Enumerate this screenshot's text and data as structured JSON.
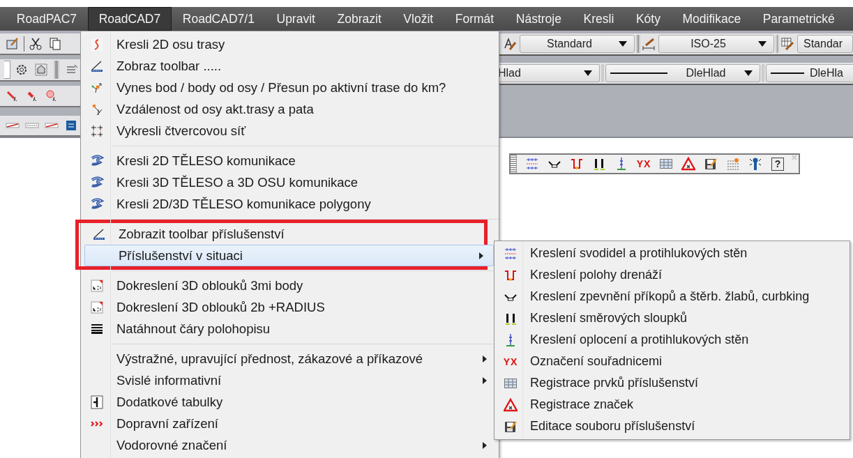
{
  "menubar": [
    {
      "label": "RoadPAC7",
      "selected": false
    },
    {
      "label": "RoadCAD7",
      "selected": true
    },
    {
      "label": "RoadCAD7/1",
      "selected": false
    },
    {
      "label": "Upravit",
      "selected": false
    },
    {
      "label": "Zobrazit",
      "selected": false
    },
    {
      "label": "Vložit",
      "selected": false
    },
    {
      "label": "Formát",
      "selected": false
    },
    {
      "label": "Nástroje",
      "selected": false
    },
    {
      "label": "Kresli",
      "selected": false
    },
    {
      "label": "Kóty",
      "selected": false
    },
    {
      "label": "Modifikace",
      "selected": false
    },
    {
      "label": "Parametrické",
      "selected": false
    }
  ],
  "toolbar_rows": [
    [
      {
        "kind": "textstyle",
        "value": "Standard"
      },
      {
        "kind": "dimstyle",
        "value": "ISO-25"
      },
      {
        "kind": "tablestyle",
        "value": "Standar"
      }
    ],
    [
      {
        "kind": "plain",
        "value": "Hlad"
      },
      {
        "kind": "linetype",
        "value": "DleHlad"
      },
      {
        "kind": "linetype",
        "value": "DleHla"
      }
    ]
  ],
  "floating_toolbar": {
    "items": [
      {
        "kind": "guardrail"
      },
      {
        "kind": "ditch"
      },
      {
        "kind": "drain"
      },
      {
        "kind": "posts"
      },
      {
        "kind": "fence"
      },
      {
        "kind": "coords",
        "text": "YX"
      },
      {
        "kind": "table"
      },
      {
        "kind": "warning"
      },
      {
        "kind": "edit"
      },
      {
        "kind": "markings"
      },
      {
        "kind": "pillar"
      },
      {
        "kind": "help",
        "text": "?"
      }
    ]
  },
  "menu": {
    "items": [
      {
        "kind": "curve",
        "label": "Kresli 2D osu trasy",
        "submenu": false,
        "selected": false,
        "outlined": false
      },
      {
        "kind": "ruler",
        "label": "Zobraz toolbar .....",
        "submenu": false,
        "selected": false,
        "outlined": false
      },
      {
        "kind": "points",
        "label": "Vynes bod / body od osy / Přesun po aktivní trase do km?",
        "submenu": false,
        "selected": false,
        "outlined": false
      },
      {
        "kind": "offset",
        "label": "Vzdálenost od osy akt.trasy a pata",
        "submenu": false,
        "selected": false,
        "outlined": false
      },
      {
        "kind": "grid",
        "label": "Vykresli čtvercovou síť",
        "submenu": false,
        "selected": false,
        "outlined": false
      },
      {
        "kind": "separator"
      },
      {
        "kind": "road",
        "label": "Kresli 2D TĚLESO komunikace",
        "submenu": false,
        "selected": false,
        "outlined": false
      },
      {
        "kind": "road",
        "label": "Kresli 3D TĚLESO a 3D OSU komunikace",
        "submenu": false,
        "selected": false,
        "outlined": false
      },
      {
        "kind": "road",
        "label": "Kresli 2D/3D TĚLESO komunikace polygony",
        "submenu": false,
        "selected": false,
        "outlined": false
      },
      {
        "kind": "separator"
      },
      {
        "kind": "ruler",
        "label": "Zobrazit toolbar příslušenství",
        "submenu": false,
        "selected": false,
        "outlined": true
      },
      {
        "kind": "plain",
        "label": "Příslušenství v situaci",
        "submenu": true,
        "selected": true,
        "outlined": true
      },
      {
        "kind": "separator"
      },
      {
        "kind": "lsp",
        "label": "Dokreslení 3D oblouků 3mi body",
        "submenu": false,
        "selected": false,
        "outlined": false
      },
      {
        "kind": "lsp",
        "label": "Dokreslení 3D oblouků 2b +RADIUS",
        "submenu": false,
        "selected": false,
        "outlined": false
      },
      {
        "kind": "lines",
        "label": "Natáhnout čáry polohopisu",
        "submenu": false,
        "selected": false,
        "outlined": false
      },
      {
        "kind": "separator"
      },
      {
        "kind": "plain",
        "label": "Výstražné, upravující přednost, zákazové a příkazové",
        "submenu": true,
        "selected": false,
        "outlined": false
      },
      {
        "kind": "plain",
        "label": "Svislé informativní",
        "submenu": true,
        "selected": false,
        "outlined": false
      },
      {
        "kind": "bracket",
        "label": "Dodatkové tabulky",
        "submenu": false,
        "selected": false,
        "outlined": false
      },
      {
        "kind": "chevrons",
        "label": "Dopravní zařízení",
        "submenu": false,
        "selected": false,
        "outlined": false
      },
      {
        "kind": "plain",
        "label": "Vodorovné značení",
        "submenu": true,
        "selected": false,
        "outlined": false
      }
    ]
  },
  "submenu": {
    "items": [
      {
        "kind": "guardrail",
        "label": "Kreslení svodidel a protihlukových stěn"
      },
      {
        "kind": "drain",
        "label": "Kreslení polohy drenáží"
      },
      {
        "kind": "ditch",
        "label": "Kreslení zpevnění příkopů a štěrb. žlabů, curbking"
      },
      {
        "kind": "posts",
        "label": "Kreslení směrových sloupků"
      },
      {
        "kind": "fence",
        "label": "Kreslení oplocení a protihlukových stěn"
      },
      {
        "kind": "coords",
        "text": "YX",
        "label": "Označení souřadnicemi"
      },
      {
        "kind": "table",
        "label": "Registrace prvků příslušenství"
      },
      {
        "kind": "warning",
        "label": "Registrace značek"
      },
      {
        "kind": "edit",
        "label": "Editace souboru příslušenství"
      }
    ]
  }
}
